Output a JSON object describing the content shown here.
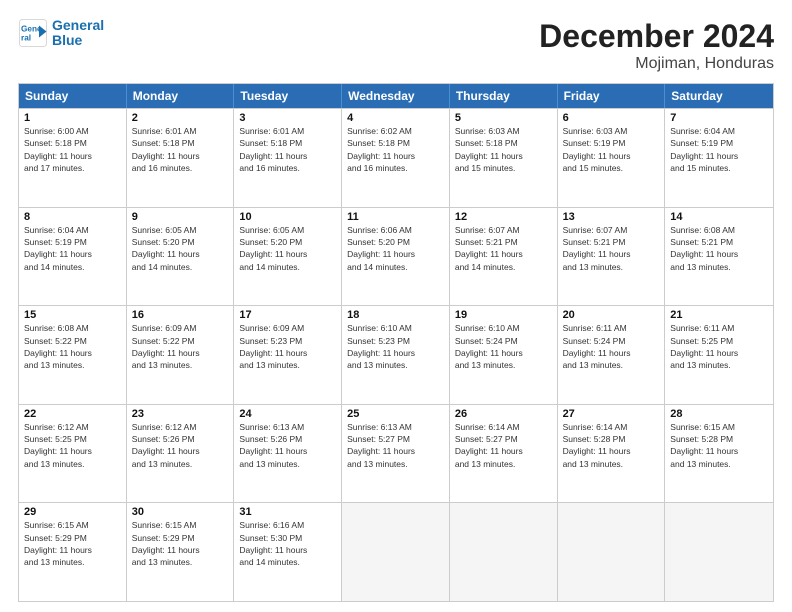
{
  "logo": {
    "line1": "General",
    "line2": "Blue"
  },
  "title": "December 2024",
  "subtitle": "Mojiman, Honduras",
  "days_of_week": [
    "Sunday",
    "Monday",
    "Tuesday",
    "Wednesday",
    "Thursday",
    "Friday",
    "Saturday"
  ],
  "weeks": [
    [
      {
        "day": 1,
        "info": "Sunrise: 6:00 AM\nSunset: 5:18 PM\nDaylight: 11 hours\nand 17 minutes."
      },
      {
        "day": 2,
        "info": "Sunrise: 6:01 AM\nSunset: 5:18 PM\nDaylight: 11 hours\nand 16 minutes."
      },
      {
        "day": 3,
        "info": "Sunrise: 6:01 AM\nSunset: 5:18 PM\nDaylight: 11 hours\nand 16 minutes."
      },
      {
        "day": 4,
        "info": "Sunrise: 6:02 AM\nSunset: 5:18 PM\nDaylight: 11 hours\nand 16 minutes."
      },
      {
        "day": 5,
        "info": "Sunrise: 6:03 AM\nSunset: 5:18 PM\nDaylight: 11 hours\nand 15 minutes."
      },
      {
        "day": 6,
        "info": "Sunrise: 6:03 AM\nSunset: 5:19 PM\nDaylight: 11 hours\nand 15 minutes."
      },
      {
        "day": 7,
        "info": "Sunrise: 6:04 AM\nSunset: 5:19 PM\nDaylight: 11 hours\nand 15 minutes."
      }
    ],
    [
      {
        "day": 8,
        "info": "Sunrise: 6:04 AM\nSunset: 5:19 PM\nDaylight: 11 hours\nand 14 minutes."
      },
      {
        "day": 9,
        "info": "Sunrise: 6:05 AM\nSunset: 5:20 PM\nDaylight: 11 hours\nand 14 minutes."
      },
      {
        "day": 10,
        "info": "Sunrise: 6:05 AM\nSunset: 5:20 PM\nDaylight: 11 hours\nand 14 minutes."
      },
      {
        "day": 11,
        "info": "Sunrise: 6:06 AM\nSunset: 5:20 PM\nDaylight: 11 hours\nand 14 minutes."
      },
      {
        "day": 12,
        "info": "Sunrise: 6:07 AM\nSunset: 5:21 PM\nDaylight: 11 hours\nand 14 minutes."
      },
      {
        "day": 13,
        "info": "Sunrise: 6:07 AM\nSunset: 5:21 PM\nDaylight: 11 hours\nand 13 minutes."
      },
      {
        "day": 14,
        "info": "Sunrise: 6:08 AM\nSunset: 5:21 PM\nDaylight: 11 hours\nand 13 minutes."
      }
    ],
    [
      {
        "day": 15,
        "info": "Sunrise: 6:08 AM\nSunset: 5:22 PM\nDaylight: 11 hours\nand 13 minutes."
      },
      {
        "day": 16,
        "info": "Sunrise: 6:09 AM\nSunset: 5:22 PM\nDaylight: 11 hours\nand 13 minutes."
      },
      {
        "day": 17,
        "info": "Sunrise: 6:09 AM\nSunset: 5:23 PM\nDaylight: 11 hours\nand 13 minutes."
      },
      {
        "day": 18,
        "info": "Sunrise: 6:10 AM\nSunset: 5:23 PM\nDaylight: 11 hours\nand 13 minutes."
      },
      {
        "day": 19,
        "info": "Sunrise: 6:10 AM\nSunset: 5:24 PM\nDaylight: 11 hours\nand 13 minutes."
      },
      {
        "day": 20,
        "info": "Sunrise: 6:11 AM\nSunset: 5:24 PM\nDaylight: 11 hours\nand 13 minutes."
      },
      {
        "day": 21,
        "info": "Sunrise: 6:11 AM\nSunset: 5:25 PM\nDaylight: 11 hours\nand 13 minutes."
      }
    ],
    [
      {
        "day": 22,
        "info": "Sunrise: 6:12 AM\nSunset: 5:25 PM\nDaylight: 11 hours\nand 13 minutes."
      },
      {
        "day": 23,
        "info": "Sunrise: 6:12 AM\nSunset: 5:26 PM\nDaylight: 11 hours\nand 13 minutes."
      },
      {
        "day": 24,
        "info": "Sunrise: 6:13 AM\nSunset: 5:26 PM\nDaylight: 11 hours\nand 13 minutes."
      },
      {
        "day": 25,
        "info": "Sunrise: 6:13 AM\nSunset: 5:27 PM\nDaylight: 11 hours\nand 13 minutes."
      },
      {
        "day": 26,
        "info": "Sunrise: 6:14 AM\nSunset: 5:27 PM\nDaylight: 11 hours\nand 13 minutes."
      },
      {
        "day": 27,
        "info": "Sunrise: 6:14 AM\nSunset: 5:28 PM\nDaylight: 11 hours\nand 13 minutes."
      },
      {
        "day": 28,
        "info": "Sunrise: 6:15 AM\nSunset: 5:28 PM\nDaylight: 11 hours\nand 13 minutes."
      }
    ],
    [
      {
        "day": 29,
        "info": "Sunrise: 6:15 AM\nSunset: 5:29 PM\nDaylight: 11 hours\nand 13 minutes."
      },
      {
        "day": 30,
        "info": "Sunrise: 6:15 AM\nSunset: 5:29 PM\nDaylight: 11 hours\nand 13 minutes."
      },
      {
        "day": 31,
        "info": "Sunrise: 6:16 AM\nSunset: 5:30 PM\nDaylight: 11 hours\nand 14 minutes."
      },
      null,
      null,
      null,
      null
    ]
  ]
}
